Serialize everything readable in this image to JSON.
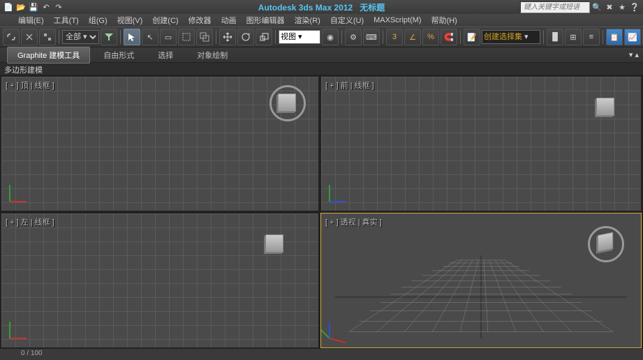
{
  "title": {
    "app": "Autodesk 3ds Max  2012",
    "doc": "无标题"
  },
  "search": {
    "placeholder": "键入关键字或短语"
  },
  "menu": {
    "edit": "编辑(E)",
    "tools": "工具(T)",
    "group": "组(G)",
    "views": "视图(V)",
    "create": "创建(C)",
    "modifiers": "修改器",
    "animation": "动画",
    "graph": "图形编辑器",
    "rendering": "渲染(R)",
    "customize": "自定义(U)",
    "maxscript": "MAXScript(M)",
    "help": "帮助(H)"
  },
  "toolbar": {
    "all_filter": "全部  ▾",
    "view_mode": "视图 ▾",
    "selection_set": "创建选择集"
  },
  "ribbon": {
    "tab_modeling": "Graphite 建模工具",
    "tab_freeform": "自由形式",
    "tab_selection": "选择",
    "tab_paint": "对象绘制",
    "sub_poly": "多边形建模"
  },
  "viewports": {
    "top_left": "[ + ] 顶 | 线框 ]",
    "top_right": "[ + ] 前 | 线框 ]",
    "bottom_left": "[ + ] 左 | 线框 ]",
    "bottom_right": "[ + ] 透视 | 真实 ]"
  },
  "status": {
    "text": "0 / 100"
  }
}
